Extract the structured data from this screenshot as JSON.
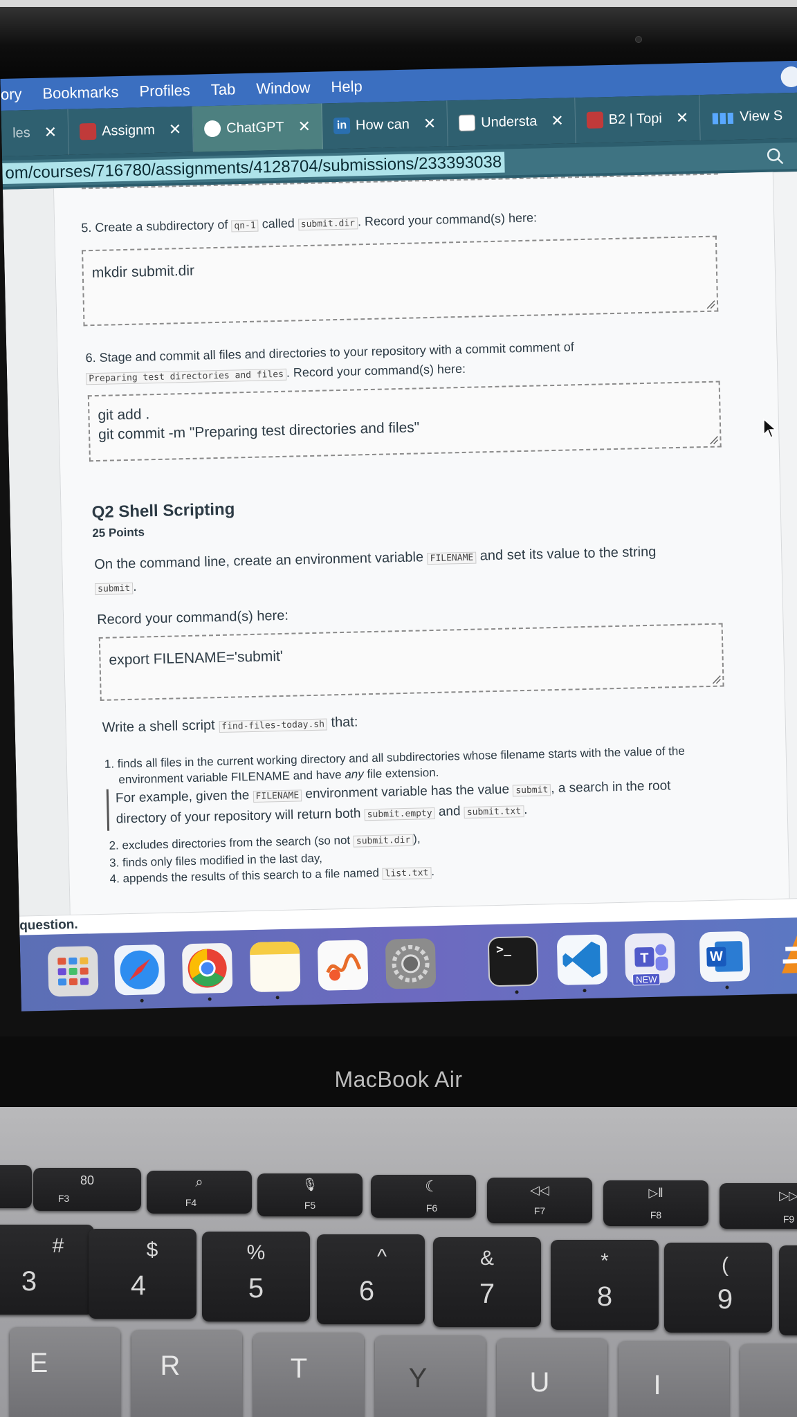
{
  "menubar": {
    "items": [
      "ory",
      "Bookmarks",
      "Profiles",
      "Tab",
      "Window",
      "Help"
    ]
  },
  "tabs": [
    {
      "label": "les",
      "icon": "partial-tab-icon"
    },
    {
      "label": "Assignm",
      "icon": "school-crest-icon"
    },
    {
      "label": "ChatGPT",
      "icon": "chatgpt-icon"
    },
    {
      "label": "How can",
      "icon": "linkedin-icon"
    },
    {
      "label": "Understa",
      "icon": "chart-icon"
    },
    {
      "label": "B2 | Topi",
      "icon": "school-crest-icon"
    },
    {
      "label": "View S",
      "icon": "bars-icon"
    }
  ],
  "url": {
    "text": "om/courses/716780/assignments/4128704/submissions/233393038"
  },
  "q5": {
    "prefix": "5. Create a subdirectory of",
    "code1": "qn-1",
    "middle": "called",
    "code2": "submit.dir",
    "suffix": ". Record your command(s) here:",
    "answer": "mkdir submit.dir"
  },
  "q6": {
    "line1": "6. Stage and commit all files and directories to your repository with a commit comment of",
    "code": "Preparing test directories and files",
    "suffix": ". Record your command(s) here:",
    "answer_line1": "git add .",
    "answer_line2": "git commit -m \"Preparing test directories and files\""
  },
  "q2": {
    "title": "Q2 Shell Scripting",
    "points": "25 Points",
    "intro_prefix": "On the command line, create an environment variable",
    "intro_code1": "FILENAME",
    "intro_mid": "and set its value to the string",
    "intro_code2": "submit",
    "intro_end": ".",
    "record_label": "Record your command(s) here:",
    "answer": "export FILENAME='submit'",
    "script_prefix": "Write a shell script",
    "script_code": "find-files-today.sh",
    "script_suffix": "that:",
    "item1_a": "1. finds all files in the current working directory and all subdirectories whose filename starts with the value of the",
    "item1_b": "environment variable FILENAME and have",
    "item1_any": "any",
    "item1_c": "file extension.",
    "ex_a": "For example, given the",
    "ex_code1": "FILENAME",
    "ex_b": "environment variable has the value",
    "ex_code2": "submit",
    "ex_c": ", a search in the root",
    "ex_d": "directory of your repository will return both",
    "ex_code3": "submit.empty",
    "ex_and": "and",
    "ex_code4": "submit.txt",
    "ex_end": ".",
    "item2_a": "2. excludes directories from the search (so not",
    "item2_code": "submit.dir",
    "item2_b": "),",
    "item3": "3. finds only files modified in the last day,",
    "item4_a": "4. appends the results of this search to a file named",
    "item4_code": "list.txt",
    "item4_b": "."
  },
  "footer": {
    "text": "question."
  },
  "dock": {
    "apps": [
      "launchpad-icon",
      "safari-icon",
      "chrome-icon",
      "notes-icon",
      "freeform-icon",
      "system-settings-icon",
      "terminal-icon",
      "vscode-icon",
      "teams-icon",
      "word-icon",
      "vlc-icon"
    ],
    "teams_badge": "NEW",
    "terminal_glyph": ">_"
  },
  "laptop": {
    "label": "MacBook Air"
  },
  "keys": {
    "fn": [
      {
        "label": "F3",
        "glyph": "80"
      },
      {
        "label": "F4",
        "glyph": "⌕"
      },
      {
        "label": "F5",
        "glyph": "🎙"
      },
      {
        "label": "F6",
        "glyph": "☾"
      },
      {
        "label": "F7",
        "glyph": "◁◁"
      },
      {
        "label": "F8",
        "glyph": "▷ǁ"
      },
      {
        "label": "F9",
        "glyph": "▷▷"
      }
    ],
    "num": [
      {
        "top": "#",
        "bot": "3"
      },
      {
        "top": "$",
        "bot": "4"
      },
      {
        "top": "%",
        "bot": "5"
      },
      {
        "top": "^",
        "bot": "6"
      },
      {
        "top": "&",
        "bot": "7"
      },
      {
        "top": "*",
        "bot": "8"
      },
      {
        "top": "(",
        "bot": "9"
      }
    ],
    "letters": [
      "E",
      "R",
      "T",
      "Y",
      "U",
      "I"
    ]
  }
}
